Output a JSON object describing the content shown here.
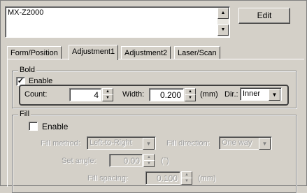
{
  "model_list": {
    "selected": "MX-Z2000"
  },
  "edit_button": "Edit",
  "tabs": [
    {
      "label": "Form/Position"
    },
    {
      "label": "Adjustment1"
    },
    {
      "label": "Adjustment2"
    },
    {
      "label": "Laser/Scan"
    }
  ],
  "active_tab": "Adjustment1",
  "bold": {
    "title": "Bold",
    "enable_label": "Enable",
    "enable_checked": true,
    "count_label": "Count:",
    "count_value": "4",
    "width_label": "Width:",
    "width_value": "0.200",
    "width_unit": "(mm)",
    "dir_label": "Dir.:",
    "dir_value": "Inner"
  },
  "fill": {
    "title": "Fill",
    "enable_label": "Enable",
    "enable_checked": false,
    "fill_method_label": "Fill method:",
    "fill_method_value": "Left-to-Right",
    "fill_direction_label": "Fill direction:",
    "fill_direction_value": "One way",
    "set_angle_label": "Set angle:",
    "set_angle_value": "0.00",
    "set_angle_unit": "(°)",
    "fill_spacing_label": "Fill spacing:",
    "fill_spacing_value": "0.100",
    "fill_spacing_unit": "(mm)"
  },
  "colors": {
    "face": "#d4d0c8",
    "shadow": "#808080",
    "highlight": "#ffffff",
    "disabled_text": "#a0a0a0"
  },
  "icons": {
    "scroll_up": "▲",
    "scroll_down": "▼",
    "dropdown": "▼",
    "spin_up": "▲",
    "spin_down": "▼",
    "check": "✓"
  }
}
